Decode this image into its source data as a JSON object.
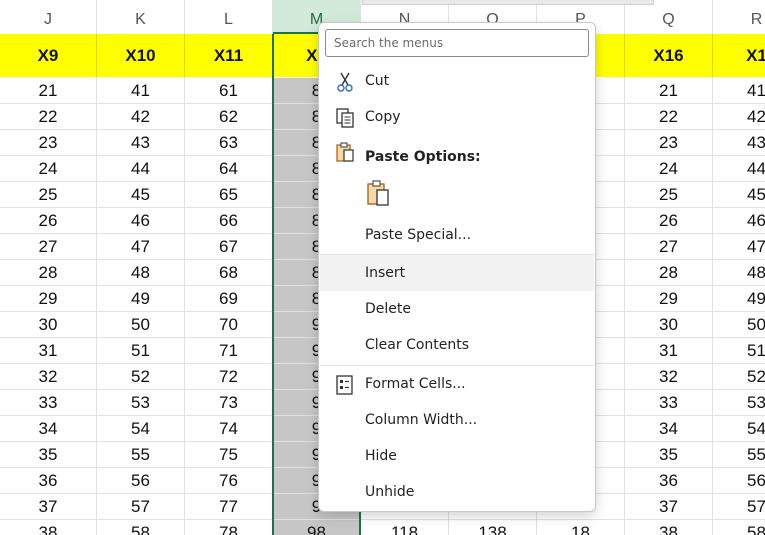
{
  "spreadsheet": {
    "columns": [
      "J",
      "K",
      "L",
      "M",
      "N",
      "O",
      "P",
      "Q",
      "R"
    ],
    "selected_column": "M",
    "header_row": [
      "X9",
      "X10",
      "X11",
      "X1",
      "",
      "",
      "",
      "X16",
      "X1"
    ],
    "rows": [
      [
        "21",
        "41",
        "61",
        "8",
        "",
        "",
        "",
        "21",
        "41"
      ],
      [
        "22",
        "42",
        "62",
        "8",
        "",
        "",
        "",
        "22",
        "42"
      ],
      [
        "23",
        "43",
        "63",
        "8",
        "",
        "",
        "",
        "23",
        "43"
      ],
      [
        "24",
        "44",
        "64",
        "8",
        "",
        "",
        "",
        "24",
        "44"
      ],
      [
        "25",
        "45",
        "65",
        "8",
        "",
        "",
        "",
        "25",
        "45"
      ],
      [
        "26",
        "46",
        "66",
        "8",
        "",
        "",
        "",
        "26",
        "46"
      ],
      [
        "27",
        "47",
        "67",
        "8",
        "",
        "",
        "",
        "27",
        "47"
      ],
      [
        "28",
        "48",
        "68",
        "8",
        "",
        "",
        "",
        "28",
        "48"
      ],
      [
        "29",
        "49",
        "69",
        "8",
        "",
        "",
        "",
        "29",
        "49"
      ],
      [
        "30",
        "50",
        "70",
        "9",
        "",
        "",
        "",
        "30",
        "50"
      ],
      [
        "31",
        "51",
        "71",
        "9",
        "",
        "",
        "",
        "31",
        "51"
      ],
      [
        "32",
        "52",
        "72",
        "9",
        "",
        "",
        "",
        "32",
        "52"
      ],
      [
        "33",
        "53",
        "73",
        "9",
        "",
        "",
        "",
        "33",
        "53"
      ],
      [
        "34",
        "54",
        "74",
        "9",
        "",
        "",
        "",
        "34",
        "54"
      ],
      [
        "35",
        "55",
        "75",
        "9",
        "",
        "",
        "",
        "35",
        "55"
      ],
      [
        "36",
        "56",
        "76",
        "9",
        "",
        "",
        "",
        "36",
        "56"
      ],
      [
        "37",
        "57",
        "77",
        "9",
        "",
        "",
        "",
        "37",
        "57"
      ],
      [
        "38",
        "58",
        "78",
        "98",
        "118",
        "138",
        "18",
        "38",
        "58"
      ]
    ],
    "colors": {
      "header_fill": "#ffff00",
      "selected_fill": "#c6c6c6",
      "selection_border": "#1e7145"
    }
  },
  "context_menu": {
    "search_placeholder": "Search the menus",
    "items": {
      "cut": "Cut",
      "copy": "Copy",
      "paste_options": "Paste Options:",
      "paste_special": "Paste Special...",
      "insert": "Insert",
      "delete": "Delete",
      "clear_contents": "Clear Contents",
      "format_cells": "Format Cells...",
      "column_width": "Column Width...",
      "hide": "Hide",
      "unhide": "Unhide"
    },
    "icons": [
      "scissors-icon",
      "copy-icon",
      "clipboard-icon",
      "paste-icon",
      "format-cells-icon"
    ]
  }
}
